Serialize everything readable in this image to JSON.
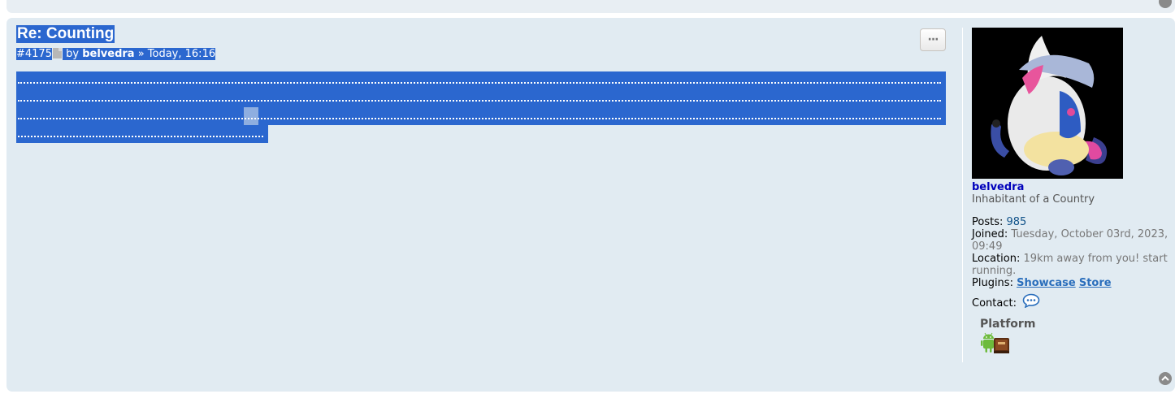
{
  "post": {
    "title": "Re: Counting",
    "number": "#4175",
    "by_label": " by ",
    "author": "belvedra",
    "separator": " » ",
    "time": "Today, 16:16"
  },
  "post_menu": {
    "label": "···"
  },
  "profile": {
    "username": "belvedra",
    "rank": "Inhabitant of a Country",
    "posts_label": "Posts:",
    "posts_value": "985",
    "joined_label": "Joined:",
    "joined_value": "Tuesday, October 03rd, 2023, 09:49",
    "location_label": "Location:",
    "location_value": "19km away from you! start running.",
    "plugins_label": "Plugins:",
    "plugins_links": [
      "Showcase",
      "Store"
    ],
    "contact_label": "Contact:",
    "platform_title": "Platform"
  },
  "icons": {
    "post_link": "document-icon",
    "menu": "ellipsis-icon",
    "contact": "speech-bubble-icon",
    "platform": [
      "android-icon",
      "book-icon"
    ],
    "back_to_top": "chevron-up-circle-icon"
  },
  "colors": {
    "post_background": "#e1ebf2",
    "selection": "#2b67cf",
    "username": "#0000bb",
    "link": "#105289"
  }
}
